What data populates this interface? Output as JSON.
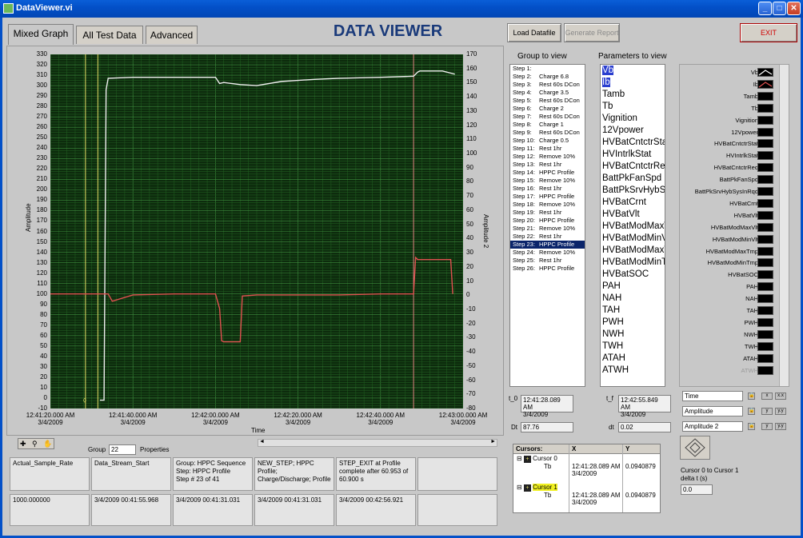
{
  "window": {
    "title": "DataViewer.vi"
  },
  "tabs": [
    {
      "label": "Mixed Graph",
      "active": true
    },
    {
      "label": "All Test Data",
      "active": false
    },
    {
      "label": "Advanced",
      "active": false
    }
  ],
  "header": {
    "title": "DATA VIEWER"
  },
  "buttons": {
    "load": "Load Datafile",
    "report": "Generate Report",
    "exit": "EXIT"
  },
  "graph": {
    "ylabel": "Amplitude",
    "y2label": "Amplitude 2",
    "xlabel": "Time"
  },
  "chart_data": {
    "type": "line",
    "xlabel": "Time",
    "ylabel": "Amplitude",
    "y2label": "Amplitude 2",
    "xlim": [
      "12:41:20.000",
      "12:43:00.000"
    ],
    "ylim": [
      -10,
      330
    ],
    "y2lim": [
      -80,
      170
    ],
    "y_ticks": [
      330,
      320,
      310,
      300,
      290,
      280,
      270,
      260,
      250,
      240,
      230,
      220,
      210,
      200,
      190,
      180,
      170,
      160,
      150,
      140,
      130,
      120,
      110,
      100,
      90,
      80,
      70,
      60,
      50,
      40,
      30,
      20,
      10,
      0,
      -10
    ],
    "y2_ticks": [
      170,
      160,
      150,
      140,
      130,
      120,
      110,
      100,
      90,
      80,
      70,
      60,
      50,
      40,
      30,
      20,
      10,
      0,
      -10,
      -20,
      -30,
      -40,
      -50,
      -60,
      -70,
      -80
    ],
    "x_ticks": [
      {
        "time": "12:41:20.000 AM",
        "date": "3/4/2009"
      },
      {
        "time": "12:41:40.000 AM",
        "date": "3/4/2009"
      },
      {
        "time": "12:42:00.000 AM",
        "date": "3/4/2009"
      },
      {
        "time": "12:42:20.000 AM",
        "date": "3/4/2009"
      },
      {
        "time": "12:42:40.000 AM",
        "date": "3/4/2009"
      },
      {
        "time": "12:43:00.000 AM",
        "date": "3/4/2009"
      }
    ],
    "grid": true,
    "series": [
      {
        "name": "Vb",
        "color": "#f0f0f0",
        "axis": "left",
        "x": [
          12,
          13,
          13.5,
          14,
          20,
          40,
          41,
          42,
          46,
          50,
          56,
          60,
          64,
          70,
          80,
          88,
          89,
          89.5,
          95,
          98
        ],
        "y": [
          -2,
          -2,
          296,
          307,
          308,
          308,
          302,
          303,
          301,
          300,
          304,
          305,
          306,
          307,
          308,
          309,
          313,
          314,
          314,
          311
        ]
      },
      {
        "name": "Ib",
        "color": "#e05050",
        "axis": "left",
        "x": [
          0,
          14,
          15,
          20,
          30,
          40,
          41,
          41.5,
          42,
          46,
          46.5,
          50,
          60,
          70,
          80,
          88,
          88.5,
          89,
          97,
          97.5
        ],
        "y": [
          100,
          100,
          93,
          99,
          100,
          100,
          86,
          55,
          54,
          54,
          98,
          99,
          99,
          99,
          100,
          100,
          135,
          133,
          133,
          100
        ]
      }
    ],
    "cursors": [
      {
        "name": "Cursor 0",
        "x": 8.5,
        "color": "#e5e066"
      },
      {
        "name": "Cursor 1",
        "x": 11.5,
        "color": "#e5e066"
      },
      {
        "name": "t_f",
        "x": 88,
        "color": "#e08080"
      }
    ]
  },
  "tools": {
    "group_label": "Group",
    "group_value": "22",
    "properties_label": "Properties"
  },
  "data_table": {
    "headers": [
      "Actual_Sample_Rate",
      "Data_Stream_Start",
      "Group:  HPPC Sequence\nStep: HPPC Profile\nStep # 23 of 41",
      "NEW_STEP; HPPC Profile; Charge/Discharge; Profile",
      "STEP_EXIT at  Profile complete after 60.953 of 60.900 s",
      ""
    ],
    "values": [
      "1000.000000",
      "3/4/2009 00:41:55.968",
      "3/4/2009 00:41:31.031",
      "3/4/2009 00:41:31.031",
      "3/4/2009 00:42:56.921",
      ""
    ]
  },
  "group_view": {
    "title": "Group to view",
    "items": [
      {
        "n": "Step 1:",
        "t": ""
      },
      {
        "n": "Step 2:",
        "t": "Charge 6.8"
      },
      {
        "n": "Step 3:",
        "t": "Rest 60s DCon"
      },
      {
        "n": "Step 4:",
        "t": "Charge 3.5"
      },
      {
        "n": "Step 5:",
        "t": "Rest 60s DCon"
      },
      {
        "n": "Step 6:",
        "t": "Charge 2"
      },
      {
        "n": "Step 7:",
        "t": "Rest 60s DCon"
      },
      {
        "n": "Step 8:",
        "t": "Charge 1"
      },
      {
        "n": "Step 9:",
        "t": "Rest 60s DCon"
      },
      {
        "n": "Step 10:",
        "t": "Charge 0.5"
      },
      {
        "n": "Step 11:",
        "t": "Rest 1hr"
      },
      {
        "n": "Step 12:",
        "t": "Remove 10%"
      },
      {
        "n": "Step 13:",
        "t": "Rest 1hr"
      },
      {
        "n": "Step 14:",
        "t": "HPPC Profile"
      },
      {
        "n": "Step 15:",
        "t": "Remove 10%"
      },
      {
        "n": "Step 16:",
        "t": "Rest 1hr"
      },
      {
        "n": "Step 17:",
        "t": "HPPC Profile"
      },
      {
        "n": "Step 18:",
        "t": "Remove 10%"
      },
      {
        "n": "Step 19:",
        "t": "Rest 1hr"
      },
      {
        "n": "Step 20:",
        "t": "HPPC Profile"
      },
      {
        "n": "Step 21:",
        "t": "Remove 10%"
      },
      {
        "n": "Step 22:",
        "t": "Rest 1hr"
      },
      {
        "n": "Step 23:",
        "t": "HPPC Profile",
        "sel": true
      },
      {
        "n": "Step 24:",
        "t": "Remove 10%"
      },
      {
        "n": "Step 25:",
        "t": "Rest 1hr"
      },
      {
        "n": "Step 26:",
        "t": "HPPC Profile"
      }
    ]
  },
  "params_view": {
    "title": "Parameters to view",
    "items": [
      {
        "t": "Vb",
        "sel": true
      },
      {
        "t": "Ib",
        "sel": true
      },
      {
        "t": "Tamb"
      },
      {
        "t": "Tb"
      },
      {
        "t": "Vignition"
      },
      {
        "t": "12Vpower"
      },
      {
        "t": "HVBatCntctrStat"
      },
      {
        "t": "HVIntrlkStat"
      },
      {
        "t": "HVBatCntctrReq"
      },
      {
        "t": "BattPkFanSpd"
      },
      {
        "t": "BattPkSrvHybSysInRqd"
      },
      {
        "t": "HVBatCrnt"
      },
      {
        "t": "HVBatVlt"
      },
      {
        "t": "HVBatModMaxVlt"
      },
      {
        "t": "HVBatModMinVlt"
      },
      {
        "t": "HVBatModMaxTmp"
      },
      {
        "t": "HVBatModMinTmp"
      },
      {
        "t": "HVBatSOC"
      },
      {
        "t": "PAH"
      },
      {
        "t": "NAH"
      },
      {
        "t": "TAH"
      },
      {
        "t": "PWH"
      },
      {
        "t": "NWH"
      },
      {
        "t": "TWH"
      },
      {
        "t": "ATAH"
      },
      {
        "t": "ATWH"
      }
    ]
  },
  "plot_legend": [
    {
      "t": "Vb",
      "style": "white-line"
    },
    {
      "t": "Ib",
      "style": "red-line"
    },
    {
      "t": "Tamb"
    },
    {
      "t": "Tb"
    },
    {
      "t": "Vignition"
    },
    {
      "t": "12Vpower"
    },
    {
      "t": "HVBatCntctrStat"
    },
    {
      "t": "HVIntrlkStat"
    },
    {
      "t": "HVBatCntctrReq"
    },
    {
      "t": "BattPkFanSpd"
    },
    {
      "t": "BattPkSrvHybSysInRqd"
    },
    {
      "t": "HVBatCrnt"
    },
    {
      "t": "HVBatVlt"
    },
    {
      "t": "HVBatModMaxVlt"
    },
    {
      "t": "HVBatModMinVlt"
    },
    {
      "t": "HVBatModMaxTmp"
    },
    {
      "t": "HVBatModMinTmp"
    },
    {
      "t": "HVBatSOC"
    },
    {
      "t": "PAH"
    },
    {
      "t": "NAH"
    },
    {
      "t": "TAH"
    },
    {
      "t": "PWH"
    },
    {
      "t": "NWH"
    },
    {
      "t": "TWH"
    },
    {
      "t": "ATAH"
    },
    {
      "t": "ATWH"
    }
  ],
  "scale_legend": [
    "Time",
    "Amplitude",
    "Amplitude 2"
  ],
  "time_fields": {
    "t0_label": "t_0",
    "t0_value": "12:41:28.089 AM\n3/4/2009",
    "tf_label": "t_f",
    "tf_value": "12:42:55.849 AM\n3/4/2009",
    "Dt_label": "Dt",
    "Dt_value": "87.76",
    "dt_label": "dt",
    "dt_value": "0.02"
  },
  "cursors_table": {
    "headers": [
      "Cursors:",
      "X",
      "Y"
    ],
    "rows": [
      {
        "name": "Cursor 0",
        "sub": "Tb",
        "x": "12:41:28.089 AM\n3/4/2009",
        "y": "0.0940879"
      },
      {
        "name": "Cursor 1",
        "sub": "Tb",
        "x": "12:41:28.089 AM\n3/4/2009",
        "y": "0.0940879"
      }
    ]
  },
  "cursor_delta": {
    "label": "Cursor 0 to Cursor 1\ndelta t (s)",
    "value": "0.0"
  }
}
